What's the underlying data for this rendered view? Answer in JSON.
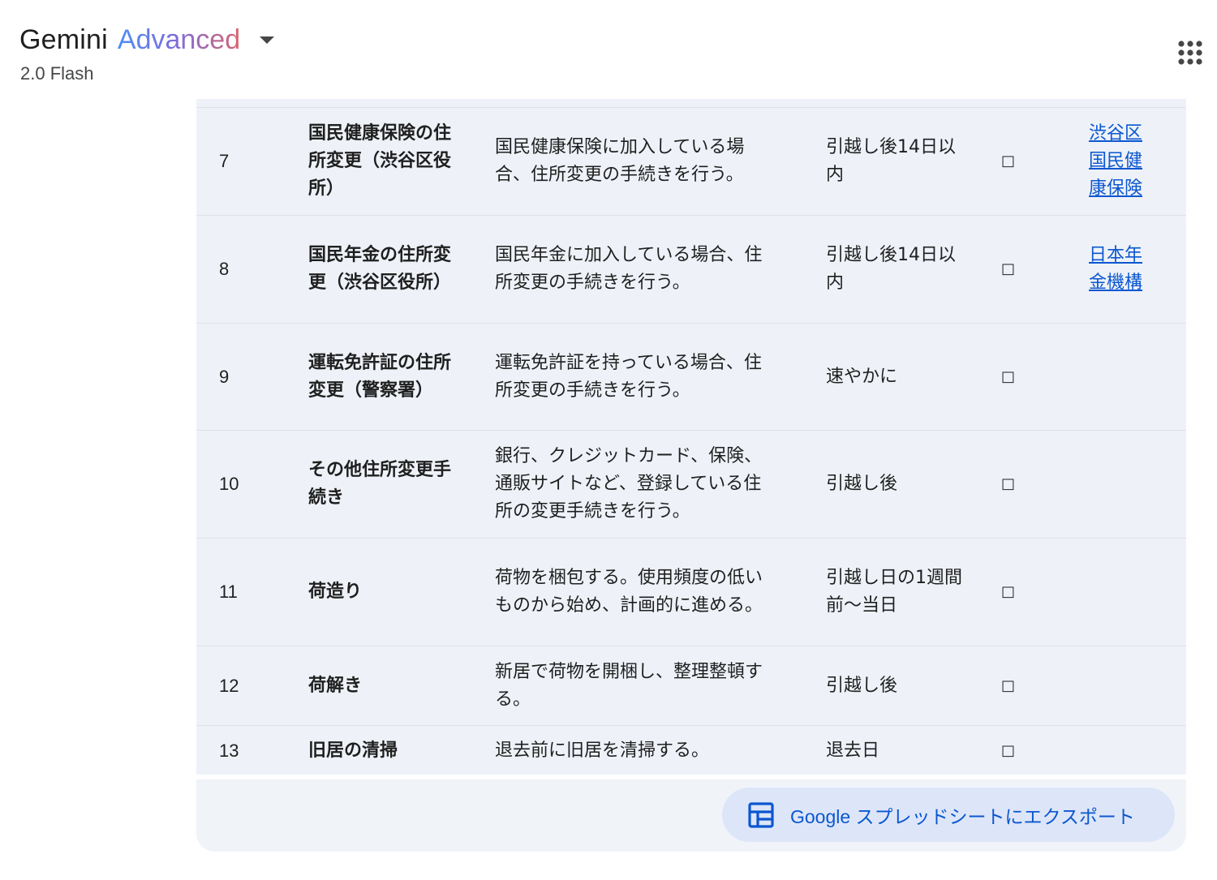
{
  "header": {
    "brand_name": "Gemini",
    "brand_tier": "Advanced",
    "model": "2.0 Flash",
    "apps_icon": "apps-grid-icon"
  },
  "table": {
    "rows": [
      {
        "no": "7",
        "task": "国民健康保険の住所変更（渋谷区役所）",
        "desc": "国民健康保険に加入している場合、住所変更の手続きを行う。",
        "due": "引越し後14日以内",
        "check": "□",
        "link": "渋谷区国民健康保険"
      },
      {
        "no": "8",
        "task": "国民年金の住所変更（渋谷区役所）",
        "desc": "国民年金に加入している場合、住所変更の手続きを行う。",
        "due": "引越し後14日以内",
        "check": "□",
        "link": "日本年金機構"
      },
      {
        "no": "9",
        "task": "運転免許証の住所変更（警察署）",
        "desc": "運転免許証を持っている場合、住所変更の手続きを行う。",
        "due": "速やかに",
        "check": "□",
        "link": ""
      },
      {
        "no": "10",
        "task": "その他住所変更手続き",
        "desc": "銀行、クレジットカード、保険、通販サイトなど、登録している住所の変更手続きを行う。",
        "due": "引越し後",
        "check": "□",
        "link": ""
      },
      {
        "no": "11",
        "task": "荷造り",
        "desc": "荷物を梱包する。使用頻度の低いものから始め、計画的に進める。",
        "due": "引越し日の1週間前〜当日",
        "check": "□",
        "link": ""
      },
      {
        "no": "12",
        "task": "荷解き",
        "desc": "新居で荷物を開梱し、整理整頓する。",
        "due": "引越し後",
        "check": "□",
        "link": ""
      },
      {
        "no": "13",
        "task": "旧居の清掃",
        "desc": "退去前に旧居を清掃する。",
        "due": "退去日",
        "check": "□",
        "link": ""
      }
    ]
  },
  "export": {
    "label": "Google スプレッドシートにエクスポート",
    "icon": "sheets-table-icon"
  },
  "colors": {
    "accent": "#0b57d0",
    "table_bg": "#eef2f8",
    "button_bg": "#dde6f8"
  }
}
